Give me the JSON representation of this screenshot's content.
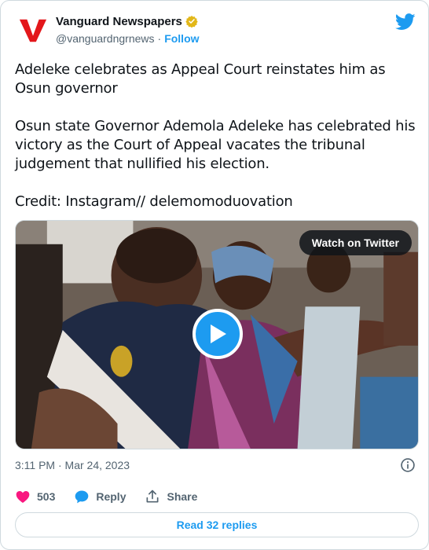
{
  "author": {
    "name": "Vanguard Newspapers",
    "handle": "@vanguardngrnews",
    "separator": "·",
    "follow_label": "Follow",
    "logo_letter": "V"
  },
  "tweet": {
    "paragraphs": [
      "Adeleke celebrates as Appeal Court reinstates him as Osun governor",
      "Osun state Governor Ademola Adeleke has celebrated his victory as the Court of Appeal vacates the tribunal judgement that nullified his election.",
      "Credit: Instagram//  delemomoduovation"
    ]
  },
  "media": {
    "watch_label": "Watch on Twitter"
  },
  "timestamp": "3:11 PM · Mar 24, 2023",
  "actions": {
    "likes_count": "503",
    "reply_label": "Reply",
    "share_label": "Share"
  },
  "read_replies_label": "Read 32 replies",
  "colors": {
    "accent": "#1d9bf0",
    "like": "#f91880",
    "logo_red": "#e3171b",
    "verified_gold": "#e2b719"
  },
  "icons": [
    "vanguard-logo",
    "verified-badge-icon",
    "twitter-bird-icon",
    "play-icon",
    "info-icon",
    "heart-icon",
    "reply-icon",
    "share-icon"
  ]
}
